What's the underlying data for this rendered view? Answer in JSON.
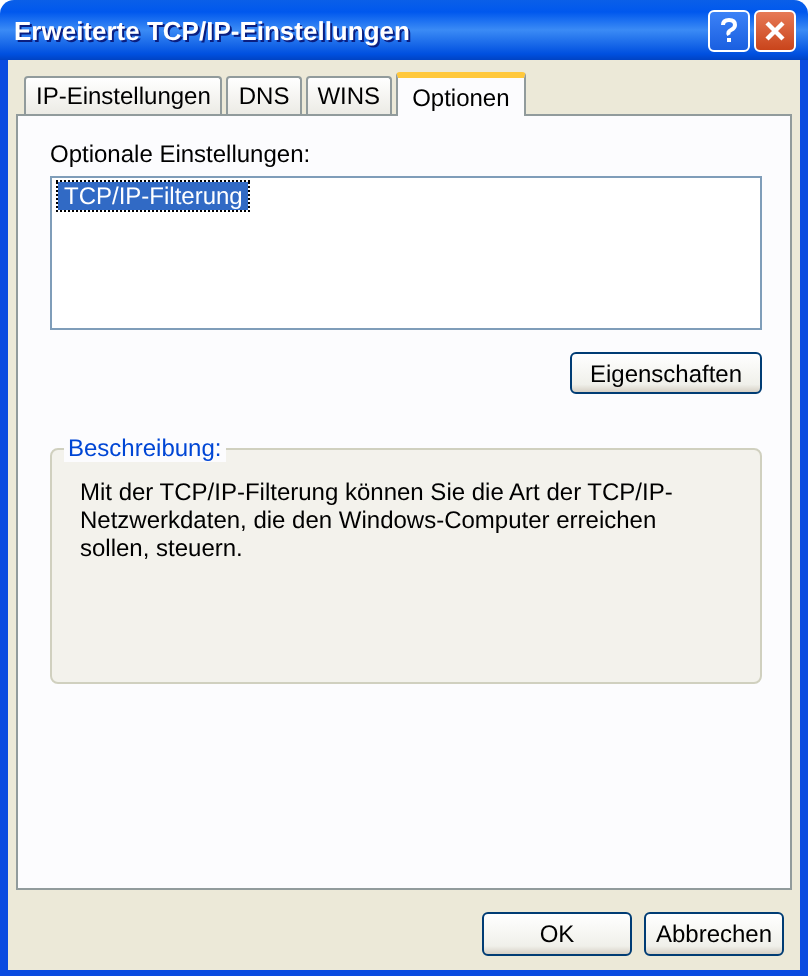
{
  "window": {
    "title": "Erweiterte TCP/IP-Einstellungen"
  },
  "tabs": [
    {
      "label": "IP-Einstellungen",
      "selected": false
    },
    {
      "label": "DNS",
      "selected": false
    },
    {
      "label": "WINS",
      "selected": false
    },
    {
      "label": "Optionen",
      "selected": true
    }
  ],
  "optional_settings": {
    "label": "Optionale Einstellungen:",
    "items": [
      {
        "label": "TCP/IP-Filterung",
        "selected": true
      }
    ]
  },
  "properties_button": "Eigenschaften",
  "description": {
    "title": "Beschreibung:",
    "text": "Mit der TCP/IP-Filterung können Sie die Art der TCP/IP-Netzwerkdaten, die den Windows-Computer erreichen sollen, steuern."
  },
  "buttons": [
    "OK",
    "Abbrechen"
  ]
}
